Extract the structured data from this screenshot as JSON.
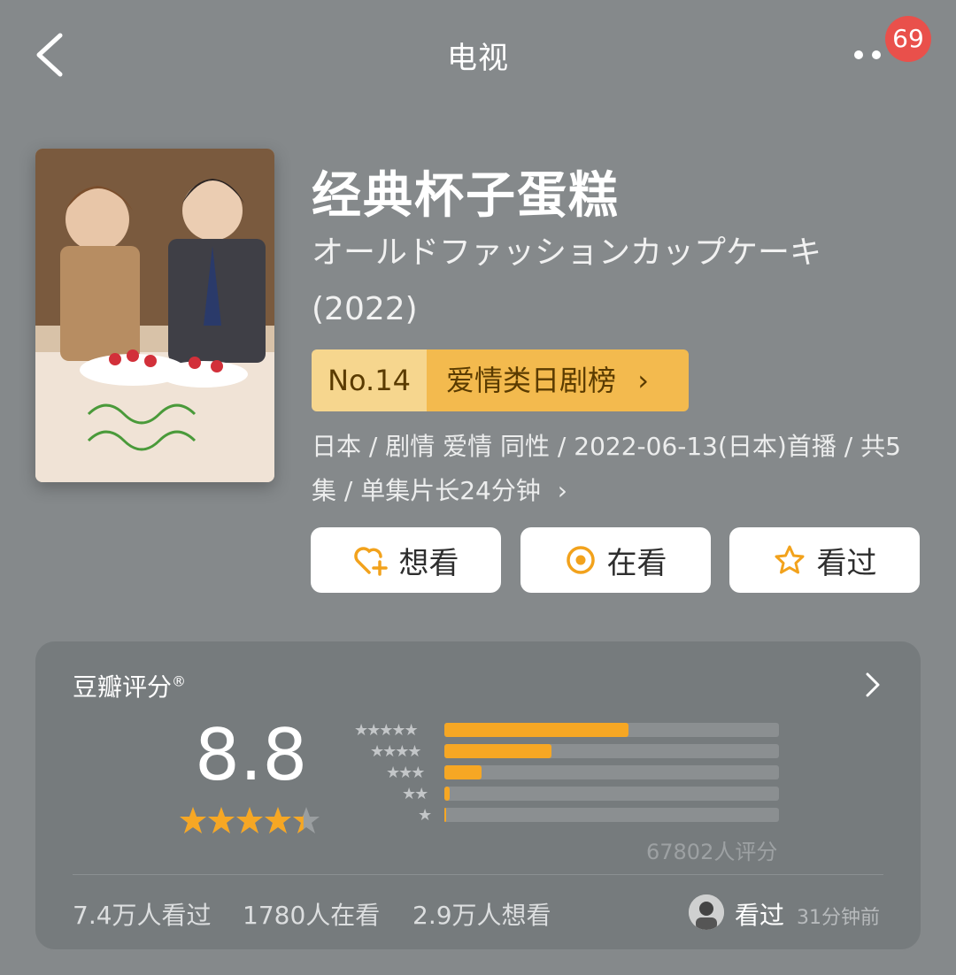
{
  "nav": {
    "title": "电视",
    "badge_count": "69"
  },
  "movie": {
    "title": "经典杯子蛋糕",
    "original_title": "オールドファッションカップケーキ(2022)",
    "rank_no": "No.14",
    "rank_list": "爱情类日剧榜",
    "meta": "日本 / 剧情 爱情 同性 / 2022-06-13(日本)首播 / 共5集 / 单集片长24分钟"
  },
  "actions": {
    "want": "想看",
    "watching": "在看",
    "watched": "看过"
  },
  "rating": {
    "label": "豆瓣评分",
    "mark": "®",
    "score": "8.8",
    "star_level": 0.88,
    "distribution": [
      {
        "stars": "★★★★★",
        "fraction": 0.55
      },
      {
        "stars": "★★★★",
        "fraction": 0.32
      },
      {
        "stars": "★★★",
        "fraction": 0.11
      },
      {
        "stars": "★★",
        "fraction": 0.015
      },
      {
        "stars": "★",
        "fraction": 0.005
      }
    ],
    "count": "67802人评分",
    "stats": {
      "watched": "7.4万人看过",
      "watching": "1780人在看",
      "want": "2.9万人想看"
    },
    "recent": {
      "status": "看过",
      "time": "31分钟前"
    }
  },
  "colors": {
    "background": "#85898b",
    "accent": "#f6a724",
    "rank_bg": "#f3ba4e",
    "badge": "#e9504b"
  }
}
